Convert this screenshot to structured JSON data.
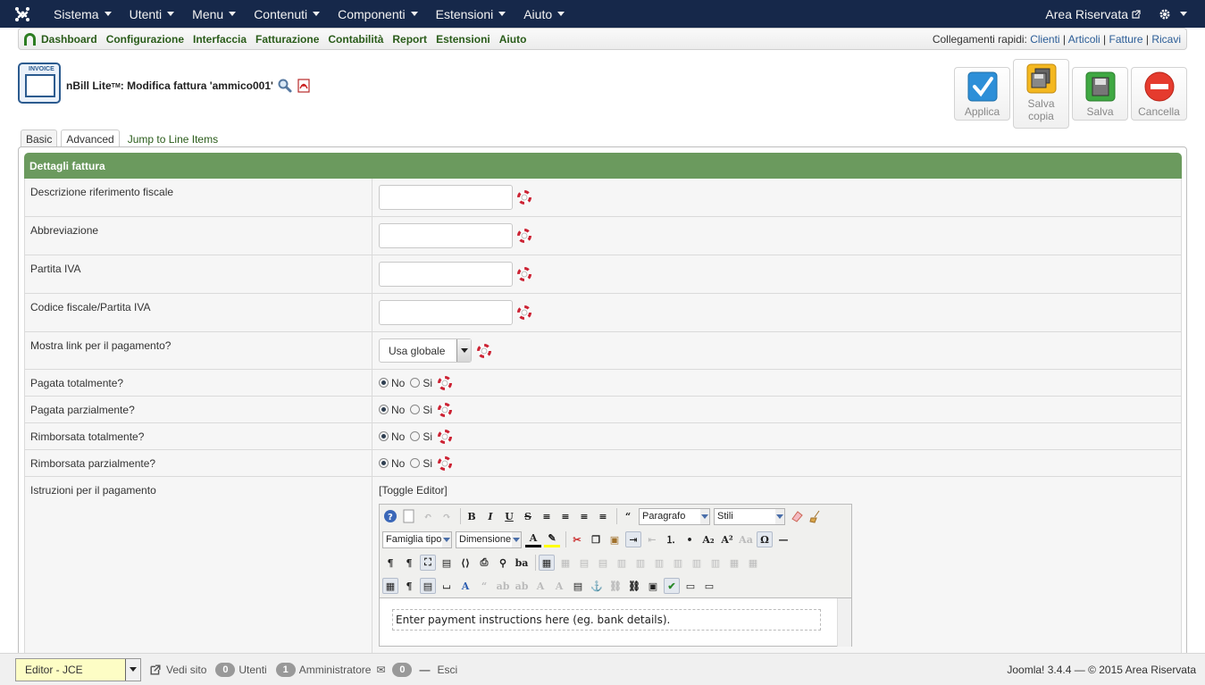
{
  "topnav": {
    "items": [
      "Sistema",
      "Utenti",
      "Menu",
      "Contenuti",
      "Componenti",
      "Estensioni",
      "Aiuto"
    ],
    "area_label": "Area Riservata"
  },
  "subnav": {
    "items": [
      "Dashboard",
      "Configurazione",
      "Interfaccia",
      "Fatturazione",
      "Contabilità",
      "Report",
      "Estensioni",
      "Aiuto"
    ],
    "quick_label": "Collegamenti rapidi:",
    "quick_links": [
      "Clienti",
      "Articoli",
      "Fatture",
      "Ricavi"
    ]
  },
  "header": {
    "icon_label": "INVOICE",
    "title_prefix": "nBill Lite",
    "title_tm": "TM",
    "title_rest": ": Modifica fattura 'ammico001'"
  },
  "toolbar": {
    "apply": "Applica",
    "save_copy_1": "Salva",
    "save_copy_2": "copia",
    "save": "Salva",
    "cancel": "Cancella"
  },
  "tabs": {
    "basic": "Basic",
    "advanced": "Advanced",
    "jump": "Jump to Line Items"
  },
  "panel": {
    "title": "Dettagli fattura",
    "fields": {
      "tax_desc": "Descrizione riferimento fiscale",
      "abbr": "Abbreviazione",
      "vat": "Partita IVA",
      "tax_code": "Codice fiscale/Partita IVA",
      "show_link": "Mostra link per il pagamento?",
      "show_link_value": "Usa globale",
      "paid_full": "Pagata totalmente?",
      "paid_part": "Pagata parzialmente?",
      "refund_full": "Rimborsata totalmente?",
      "refund_part": "Rimborsata parzialmente?",
      "instructions": "Istruzioni per il pagamento"
    },
    "radio_no": "No",
    "radio_yes": "Si"
  },
  "editor": {
    "toggle": "[Toggle Editor]",
    "format": "Paragrafo",
    "styles": "Stili",
    "font_family": "Famiglia tipo c",
    "font_size": "Dimensione de",
    "content": "Enter payment instructions here (eg. bank details)."
  },
  "footer": {
    "editor_select": "Editor - JCE",
    "view_site": "Vedi sito",
    "users_count": "0",
    "users_label": "Utenti",
    "admin_count": "1",
    "admin_label": "Amministratore",
    "msg_count": "0",
    "logout": "Esci",
    "version": "Joomla! 3.4.4 — © 2015 Area Riservata"
  },
  "colors": {
    "topbar": "#16284a",
    "panel_head": "#6b9a5e",
    "nav_green": "#2a5c1a"
  }
}
